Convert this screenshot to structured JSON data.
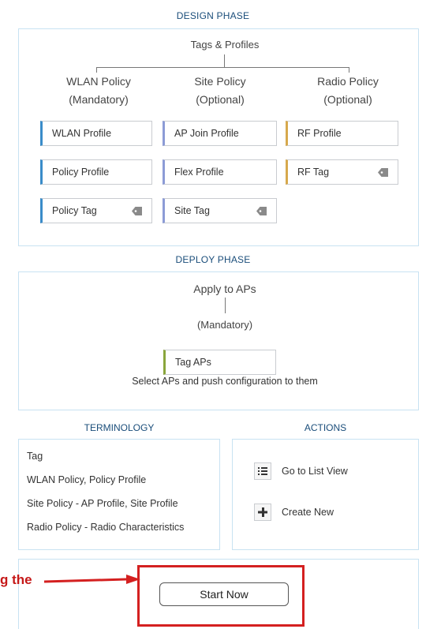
{
  "design": {
    "title": "DESIGN PHASE",
    "root": "Tags & Profiles",
    "columns": [
      {
        "title": "WLAN Policy",
        "subtitle": "(Mandatory)"
      },
      {
        "title": "Site Policy",
        "subtitle": "(Optional)"
      },
      {
        "title": "Radio Policy",
        "subtitle": "(Optional)"
      }
    ],
    "cards": [
      {
        "label": "WLAN Profile",
        "accent": "#3a8cc9"
      },
      {
        "label": "Policy Profile",
        "accent": "#3a8cc9"
      },
      {
        "label": "Policy Tag",
        "accent": "#3a8cc9",
        "icon": "tag-icon"
      },
      {
        "label": "AP Join Profile",
        "accent": "#8c9bd6"
      },
      {
        "label": "Flex Profile",
        "accent": "#8c9bd6"
      },
      {
        "label": "Site Tag",
        "accent": "#8c9bd6",
        "icon": "tag-icon"
      },
      {
        "label": "RF Profile",
        "accent": "#d7a94d"
      },
      {
        "label": "RF Tag",
        "accent": "#d7a94d",
        "icon": "tag-icon"
      }
    ]
  },
  "deploy": {
    "title": "DEPLOY PHASE",
    "root": "Apply to APs",
    "subtitle": "(Mandatory)",
    "card": {
      "label": "Tag APs",
      "accent": "#8aa53c"
    },
    "description": "Select APs and push configuration to them"
  },
  "terminology": {
    "title": "TERMINOLOGY",
    "lines": [
      "Tag",
      "WLAN Policy, Policy Profile",
      "Site Policy - AP Profile, Site Profile",
      "Radio Policy - Radio Characteristics"
    ]
  },
  "actions": {
    "title": "ACTIONS",
    "items": [
      {
        "label": "Go to List View",
        "icon": "list-icon"
      },
      {
        "label": "Create New",
        "icon": "plus-icon"
      }
    ]
  },
  "start": {
    "label": "Start Now"
  },
  "annotation": {
    "text": "g the",
    "color": "#d42020"
  }
}
